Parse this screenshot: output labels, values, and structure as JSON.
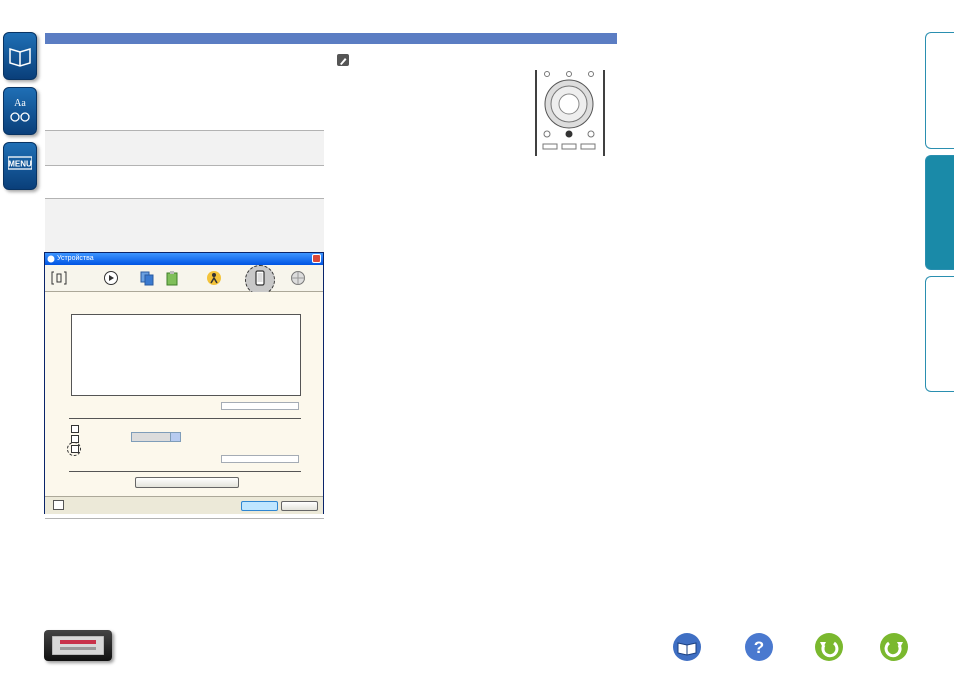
{
  "dialog": {
    "title": "Устройства"
  },
  "toolbar": {
    "icons": [
      "device-bracket-icon",
      "play-icon",
      "copy-icon",
      "clipboard-icon",
      "person-icon",
      "phone-icon",
      "globe-icon"
    ],
    "highlighted": "phone-icon"
  },
  "colors": {
    "header_bar": "#5b7dc3",
    "right_tab_active": "#1a8aa8",
    "nav_button": "#1f6fb5",
    "dialog_title": "#0054e3"
  },
  "left_nav": [
    "book-icon",
    "glossary-icon",
    "menu-icon"
  ],
  "left_nav_labels": {
    "glossary": "Aa",
    "menu": "MENU"
  },
  "bottom_nav": [
    "book-icon",
    "help-icon",
    "back-icon",
    "forward-icon"
  ],
  "help_glyph": "?"
}
